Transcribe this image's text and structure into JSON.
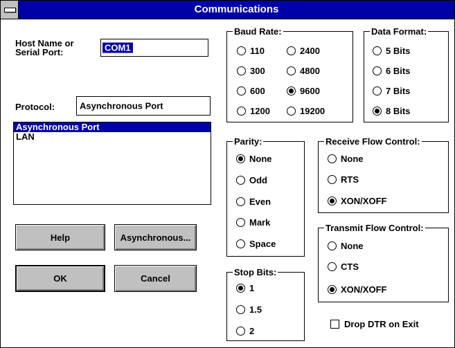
{
  "window": {
    "title": "Communications"
  },
  "host": {
    "label_line1": "Host Name or",
    "label_line2": "Serial Port:",
    "value": "COM1"
  },
  "protocol": {
    "label": "Protocol:",
    "value": "Asynchronous Port",
    "list": [
      "Asynchronous Port",
      "LAN"
    ],
    "selected_index": 0
  },
  "buttons": {
    "help": "Help",
    "asynchronous": "Asynchronous...",
    "ok": "OK",
    "cancel": "Cancel"
  },
  "baud_rate": {
    "title": "Baud Rate:",
    "options": [
      "110",
      "300",
      "600",
      "1200",
      "2400",
      "4800",
      "9600",
      "19200"
    ],
    "selected": "9600"
  },
  "data_format": {
    "title": "Data Format:",
    "options": [
      "5 Bits",
      "6 Bits",
      "7 Bits",
      "8 Bits"
    ],
    "selected": "8 Bits"
  },
  "parity": {
    "title": "Parity:",
    "options": [
      "None",
      "Odd",
      "Even",
      "Mark",
      "Space"
    ],
    "selected": "None"
  },
  "stop_bits": {
    "title": "Stop Bits:",
    "options": [
      "1",
      "1.5",
      "2"
    ],
    "selected": "1"
  },
  "receive_flow": {
    "title": "Receive Flow Control:",
    "options": [
      "None",
      "RTS",
      "XON/XOFF"
    ],
    "selected": "XON/XOFF"
  },
  "transmit_flow": {
    "title": "Transmit Flow Control:",
    "options": [
      "None",
      "CTS",
      "XON/XOFF"
    ],
    "selected": "XON/XOFF"
  },
  "drop_dtr": {
    "label": "Drop DTR on Exit",
    "checked": false
  },
  "colors": {
    "title_bar": "#0000a8",
    "button_face": "#c0c0c0",
    "selection": "#0000a8"
  }
}
